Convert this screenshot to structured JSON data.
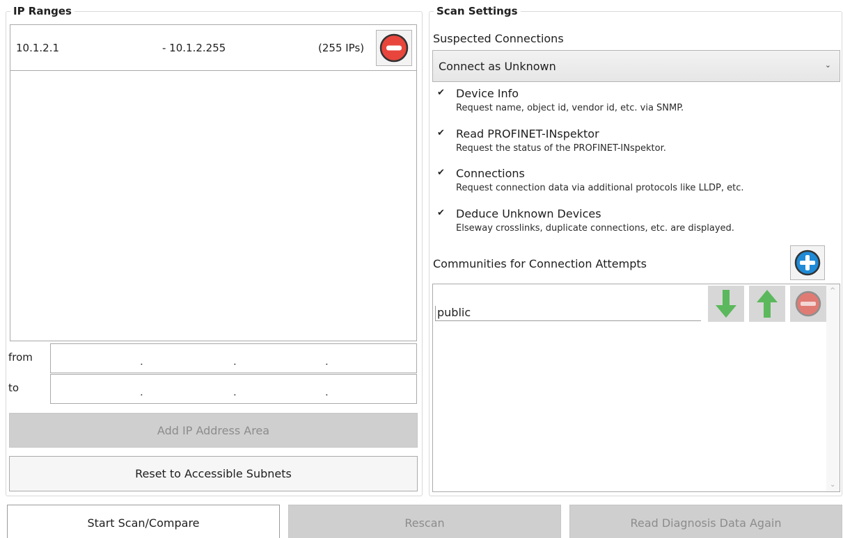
{
  "ip_ranges": {
    "title": "IP Ranges",
    "rows": [
      {
        "start": "10.1.2.1",
        "end": "- 10.1.2.255",
        "count": "(255 IPs)"
      }
    ],
    "from_label": "from",
    "to_label": "to",
    "from_dots": [
      ".",
      ".",
      "."
    ],
    "to_dots": [
      ".",
      ".",
      "."
    ],
    "add_button": "Add IP Address Area",
    "reset_button": "Reset to Accessible Subnets"
  },
  "scan_settings": {
    "title": "Scan Settings",
    "suspected_label": "Suspected Connections",
    "suspected_value": "Connect as Unknown",
    "options": [
      {
        "title": "Device Info",
        "desc": "Request name, object id, vendor id, etc. via SNMP.",
        "checked": true
      },
      {
        "title": "Read PROFINET-INspektor",
        "desc": "Request the status of the PROFINET-INspektor.",
        "checked": true
      },
      {
        "title": "Connections",
        "desc": "Request connection data via additional protocols like LLDP, etc.",
        "checked": true
      },
      {
        "title": "Deduce Unknown Devices",
        "desc": "Elseway crosslinks, duplicate connections, etc. are displayed.",
        "checked": true
      }
    ],
    "communities_label": "Communities for Connection Attempts",
    "communities": [
      "public"
    ]
  },
  "footer": {
    "start": "Start Scan/Compare",
    "rescan": "Rescan",
    "diagnosis": "Read Diagnosis Data Again"
  },
  "colors": {
    "remove_red": "#e8463c",
    "add_blue": "#1f8ad6",
    "arrow_green": "#5cb85c",
    "disabled_gray": "#cfcfcf"
  }
}
